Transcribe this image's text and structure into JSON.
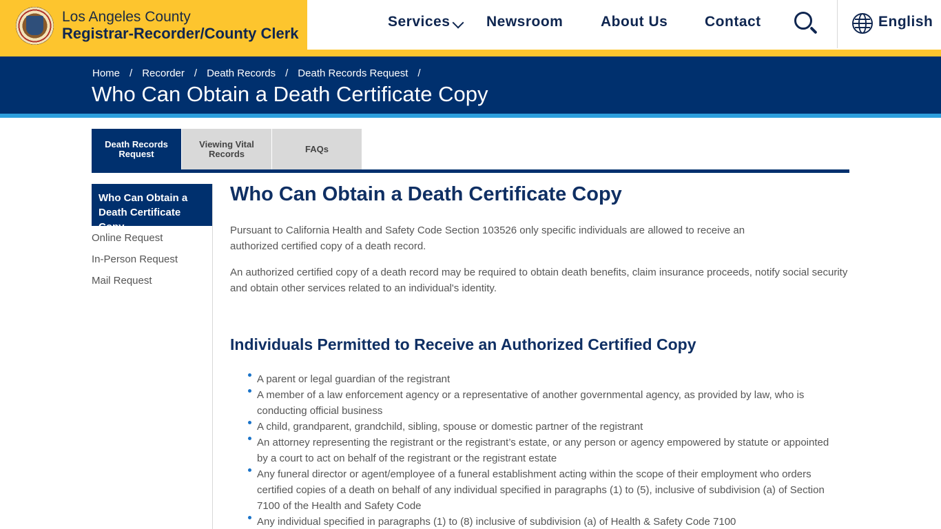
{
  "header": {
    "brand_line1": "Los Angeles County",
    "brand_line2": "Registrar-Recorder/County Clerk",
    "nav": {
      "services": "Services",
      "newsroom": "Newsroom",
      "about": "About Us",
      "contact": "Contact",
      "language": "English"
    }
  },
  "breadcrumb": [
    "Home",
    "Recorder",
    "Death Records",
    "Death Records Request"
  ],
  "page_title": "Who Can Obtain a Death Certificate Copy",
  "tabs": [
    {
      "label": "Death Records Request"
    },
    {
      "label": "Viewing Vital Records"
    },
    {
      "label": "FAQs"
    }
  ],
  "sidebar": {
    "active": "Who Can Obtain a Death Certificate Copy",
    "items": [
      "Online Request",
      "In-Person Request",
      "Mail Request"
    ]
  },
  "main": {
    "title": "Who Can Obtain a Death Certificate Copy",
    "para1": "Pursuant to California Health and Safety Code Section 103526 only specific individuals are allowed to receive an authorized certified copy of a death record.",
    "para2": "An authorized certified copy of a death record may be required to obtain death benefits, claim insurance proceeds, notify social security and obtain other services related to an individual's identity.",
    "subtitle": "Individuals Permitted to Receive an Authorized Certified Copy",
    "list": [
      "A parent or legal guardian of the registrant",
      "A member of a law enforcement agency or a representative of another governmental agency, as provided by law, who is conducting official business",
      "A child, grandparent, grandchild, sibling, spouse or domestic partner of the registrant",
      "An attorney representing the registrant or the registrant’s estate, or any person or agency empowered by statute or appointed by a court to act on behalf of the registrant or the registrant estate",
      "Any funeral director or agent/employee of a funeral establishment acting within the scope of their employment who orders certified copies of a death on behalf of any individual specified in paragraphs (1) to (5), inclusive of subdivision (a) of Section 7100 of the Health and Safety Code",
      "Any individual specified in paragraphs (1) to (8) inclusive of subdivision (a) of Health & Safety Code 7100"
    ]
  },
  "colors": {
    "gold": "#fdc52e",
    "navy": "#00306e",
    "light_blue": "#2d9fdd"
  },
  "icons": [
    "county-seal-icon",
    "chevron-down-icon",
    "search-icon",
    "globe-icon"
  ]
}
